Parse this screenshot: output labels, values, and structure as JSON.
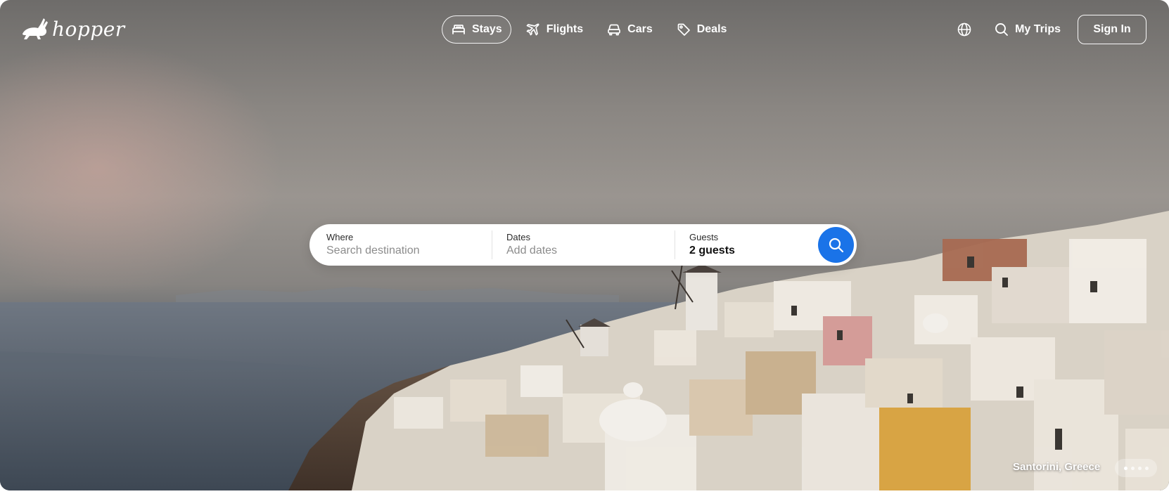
{
  "brand": {
    "name": "hopper"
  },
  "nav": {
    "tabs": [
      {
        "label": "Stays",
        "icon": "bed-icon",
        "active": true
      },
      {
        "label": "Flights",
        "icon": "plane-icon",
        "active": false
      },
      {
        "label": "Cars",
        "icon": "car-icon",
        "active": false
      },
      {
        "label": "Deals",
        "icon": "tag-icon",
        "active": false
      }
    ],
    "language_icon": "globe-icon",
    "my_trips_label": "My Trips",
    "sign_in_label": "Sign In"
  },
  "search": {
    "where_label": "Where",
    "where_placeholder": "Search destination",
    "dates_label": "Dates",
    "dates_placeholder": "Add dates",
    "guests_label": "Guests",
    "guests_value": "2 guests",
    "button_icon": "search-icon"
  },
  "hero": {
    "location": "Santorini, Greece",
    "slide_count": 4,
    "active_slide": 1
  },
  "colors": {
    "accent": "#1a73e8",
    "text_dark": "#111111",
    "placeholder": "#8c8c8c"
  }
}
